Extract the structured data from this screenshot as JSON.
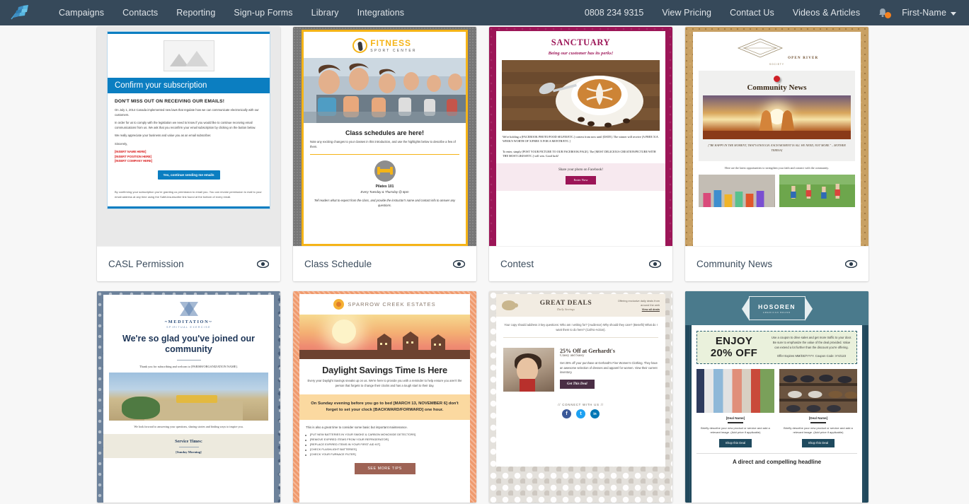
{
  "navbar": {
    "logo_icon": "feather-logo-icon",
    "left_items": [
      {
        "label": "Campaigns"
      },
      {
        "label": "Contacts"
      },
      {
        "label": "Reporting"
      },
      {
        "label": "Sign-up Forms"
      },
      {
        "label": "Library"
      },
      {
        "label": "Integrations"
      }
    ],
    "phone": "0808 234 9315",
    "right_items": [
      {
        "label": "View Pricing"
      },
      {
        "label": "Contact Us"
      },
      {
        "label": "Videos & Articles"
      }
    ],
    "bell_icon": "notification-bell-icon",
    "bell_has_badge": true,
    "user_label": "First-Name",
    "background_color": "#36495a",
    "text_color": "#dfe4e8",
    "badge_color": "#f58220"
  },
  "page": {
    "background_color": "#f7f7f7",
    "preview_icon": "eye-icon"
  },
  "templates": [
    {
      "id": "casl-permission",
      "title": "CASL Permission",
      "preview": {
        "banner": "Confirm your subscription",
        "headline": "DON'T MISS OUT ON RECEIVING OUR EMAILS!",
        "paragraph1": "On July 1, 2014 Canada implemented new laws that regulate how we can communicate electronically with our customers.",
        "paragraph2": "In order for us to comply with the legislation we need to know if you would like to continue receiving email communications from us. We ask that you reconfirm your email subscription by clicking on the button below.",
        "paragraph3": "We really appreciate your business and value you as an email subscriber.",
        "signoff": "Sincerely,",
        "placeholder1": "[INSERT NAME HERE]",
        "placeholder2": "[INSERT POSITION HERE]",
        "placeholder3": "[INSERT COMPANY HERE]",
        "button": "Yes, continue sending me emails",
        "footer": "By confirming your subscription you're granting us permission to email you. You can revoke permission to mail to your email address at any time using the SafeUnsubscribe link found at the bottom of every email.",
        "accent_color": "#0b7ec1"
      }
    },
    {
      "id": "class-schedule",
      "title": "Class Schedule",
      "preview": {
        "brand": "FITNESS",
        "brand_sub": "SPORT CENTER",
        "headline": "Class schedules are here!",
        "paragraph": "Note any exciting changes to your classes in this introduction, and use the highlights below to describe a few of them.",
        "class_name": "Pilates 101",
        "class_time": "Every Tuesday & Thursday @ 6pm",
        "class_note": "Tell readers what to expect from the class, and provide the instructor's name and contact info to answer any questions.",
        "accent_color": "#f5b417"
      }
    },
    {
      "id": "contest",
      "title": "Contest",
      "preview": {
        "brand": "SANCTUARY",
        "tagline": "Being our customer has its perks!",
        "paragraph1": "We're holding a [FACEBOOK PHOTO/FOOD SELFIE/ETC.] contest from now until [DATE]. The winner will receive [A FREE X/A WEEK'S WORTH OF X/FREE X FOR A MONTH/ETC.]",
        "paragraph2": "To enter, simply [POST YOUR PICTURE TO OUR FACEBOOK PAGE]. The [MOST DELICIOUS CREATION/PICTURE WITH THE MOST LIKES/ETC.] will win. Good luck!",
        "share_text": "Share your photo on Facebook!",
        "button": "Enter Now",
        "accent_color": "#9c1557"
      }
    },
    {
      "id": "community-news",
      "title": "Community News",
      "preview": {
        "brand": "OPEN RIVER",
        "brand_sub": "SOCIETY",
        "headline": "Community News",
        "quote": "[\"BE HAPPY IN THE MOMENT, THAT'S ENOUGH. EACH MOMENT IS ALL WE NEED, NOT MORE.\" – MOTHER TERESA]",
        "paragraph": "Here are the latest opportunities to strengthen your faith and connect with the community.",
        "accent_color": "#c8a063"
      }
    },
    {
      "id": "meditation-welcome",
      "title": "",
      "preview": {
        "brand": "~MEDITATION~",
        "brand_sub": "SPIRITUAL EXERCISE",
        "headline": "We're so glad you've joined our community",
        "paragraph1": "Thank you for subscribing and welcom to [PARISH/ORGANIZATION NAME].",
        "paragraph2": "We look forward to answering your questions, sharing stories and finding ways to inspire you.",
        "service_heading": "Service Times:",
        "service_time": "[Sunday Morning]",
        "accent_color": "#1d3557"
      }
    },
    {
      "id": "daylight-savings",
      "title": "",
      "preview": {
        "brand": "SPARROW CREEK ESTATES",
        "headline": "Daylight Savings Time Is Here",
        "paragraph": "Every year Daylight Savings sneaks up on us. We're here to provide you with a reminder to help ensure you aren't the person that forgets to change their clocks and has a tough start to their day.",
        "callout": "On Sunday evening before you go to bed [MARCH 13, NOVEMBER 6] don't forget to set your clock [BACKWARD/FORWARD] one hour.",
        "list_intro": "This is also a great time to consider some basic but important maintenance.",
        "list": [
          "[PUT NEW BATTERIES IN YOUR SMOKE & CARBON MONOXIDE DETECTORS]",
          "[REMOVE EXPIRED ITEMS FROM YOUR REFRIGERATOR]",
          "[REPLACE EXPIRED ITEMS IN YOUR FIRST AID KIT]",
          "[CHECK FLASHLIGHT BATTERIES]",
          "[CHECK YOUR FURNACE FILTER]"
        ],
        "button": "SEE MORE TIPS",
        "accent_color": "#f09a6d"
      }
    },
    {
      "id": "great-deals",
      "title": "",
      "preview": {
        "brand": "GREAT DEALS",
        "brand_sub": "Daily Savings",
        "header_note": "Offering exclusive daily deals from around the web",
        "header_link": "View all deals",
        "paragraph": "Your copy should address 3 key questions: Who am I writing for? (Audience) Why should they care? (Benefit) What do I want them to do here? (Call-to-Action).",
        "deal_title": "25% Off at Gerhardt's",
        "deal_sub": "Classy and Sassy",
        "deal_body": "Get 25% off your purchase at Gerhardt's Fine Women's Clothing. They have an awesome selection of dresses and apparel for women. View their current inventory.",
        "button": "Get This Deal",
        "connect": "// CONNECT WITH US //",
        "socials": [
          "f",
          "t",
          "in"
        ],
        "accent_color": "#4a2e45"
      }
    },
    {
      "id": "hosoren-coupon",
      "title": "",
      "preview": {
        "brand": "HOSOREN",
        "brand_sub": "AMERICAN BRAND",
        "coupon_line1": "ENJOY",
        "coupon_line2": "20% OFF",
        "coupon_text": "Use a coupon to drive sales and get more traffic to your door. Be sure to emphasize the value of the deal provided. Value can extend a lot further than the discount you're offering.",
        "coupon_expiry": "Offer Expires MM/DD/YYYY. Coupon Code: XYZ123",
        "deal1_name": "[Deal Name]",
        "deal2_name": "[Deal Name]",
        "deal_body": "Briefly describe your new product or service and add a relevant image. (Add price if applicable)",
        "button": "Shop this Deal",
        "headline": "A direct and compelling headline",
        "accent_color": "#1f4a5e"
      }
    }
  ]
}
